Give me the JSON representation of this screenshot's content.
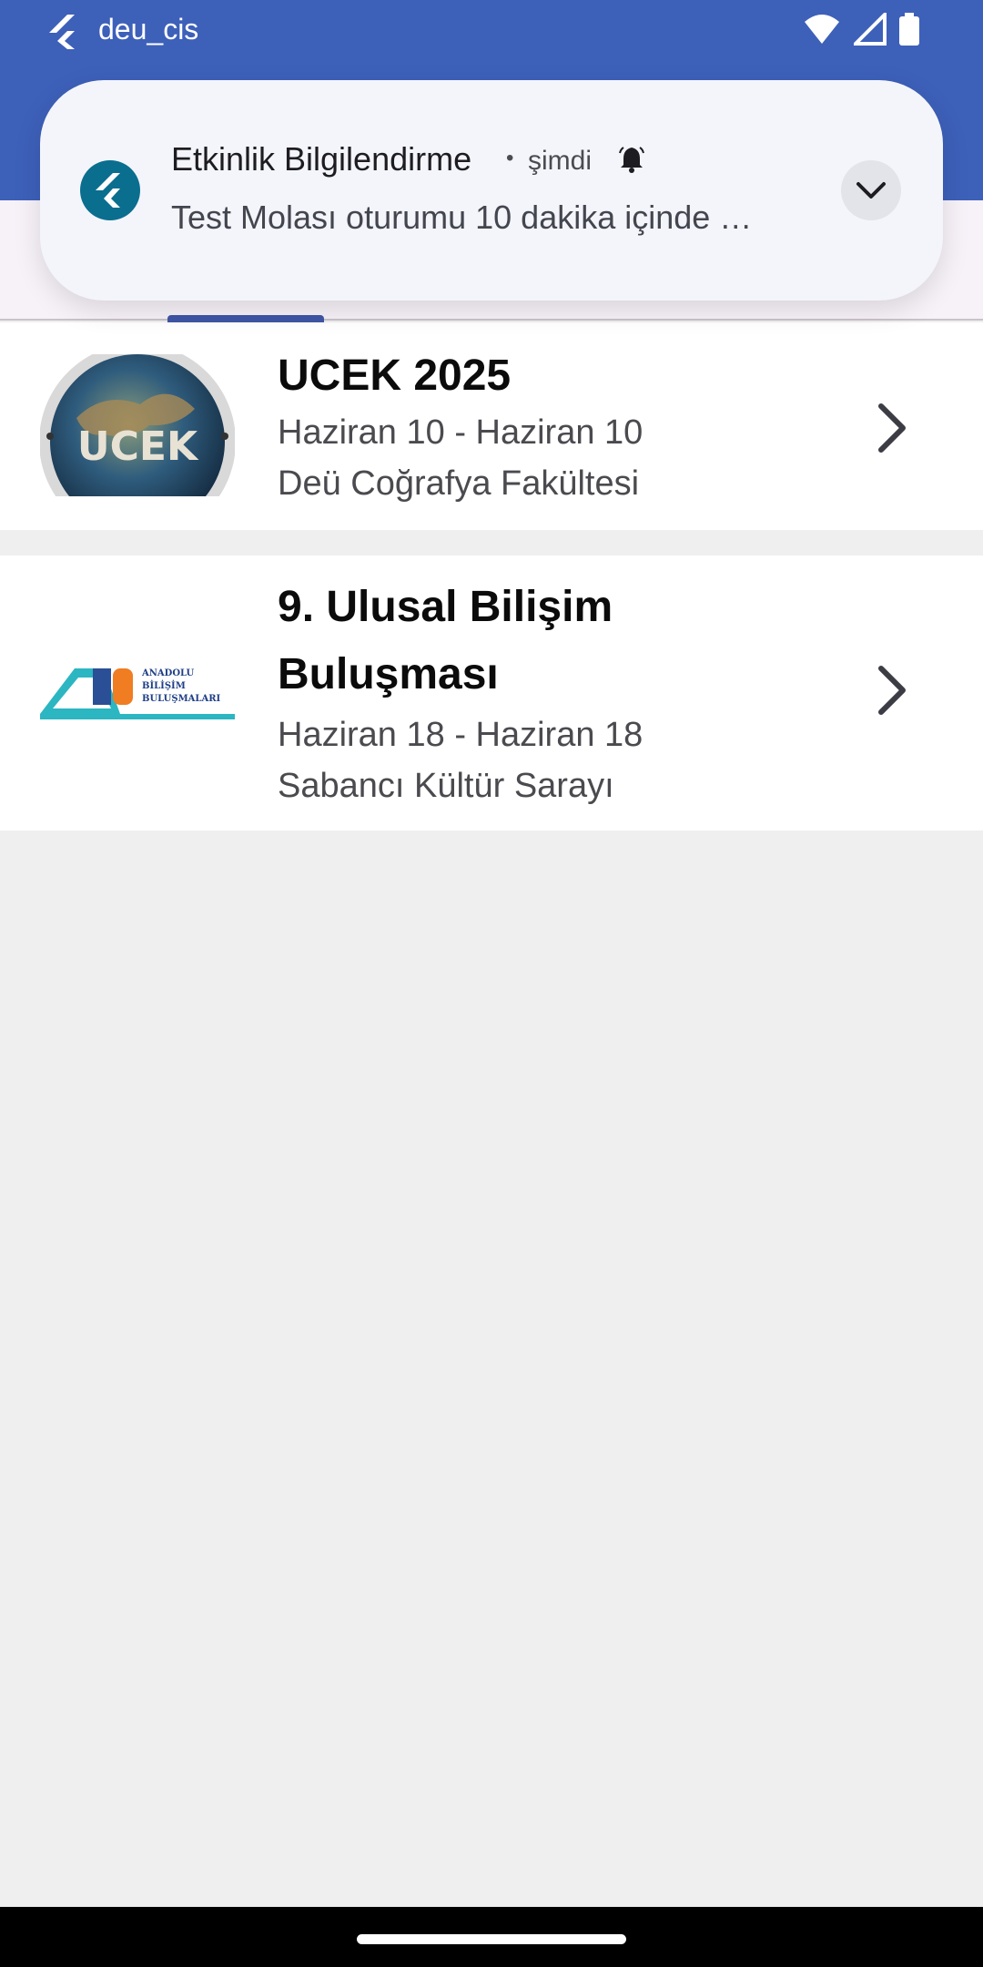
{
  "status_bar": {
    "app_name": "deu_cis",
    "icons": [
      "flutter-icon",
      "wifi-icon",
      "signal-icon",
      "battery-icon"
    ]
  },
  "notification": {
    "title": "Etkinlik Bilgilendirme",
    "separator": "•",
    "time": "şimdi",
    "body": "Test Molası oturumu 10 dakika içinde …",
    "icons": [
      "flutter-icon",
      "bell-icon",
      "chevron-down-icon"
    ]
  },
  "events": [
    {
      "title": "UCEK 2025",
      "date": "Haziran 10 - Haziran 10",
      "venue": "Deü Coğrafya Fakültesi",
      "logo_text": "UCEK"
    },
    {
      "title": "9. Ulusal Bilişim Buluşması",
      "date": "Haziran 18 - Haziran 18",
      "venue": "Sabancı Kültür Sarayı",
      "logo_text": [
        "ANADOLU",
        "BİLİŞİM",
        "BULUŞMALARI"
      ]
    }
  ],
  "colors": {
    "primary": "#3d60b9",
    "tab_indicator": "#3f56a6",
    "notification_bg": "#f4f5fb",
    "flutter_badge": "#0a6e8f"
  }
}
